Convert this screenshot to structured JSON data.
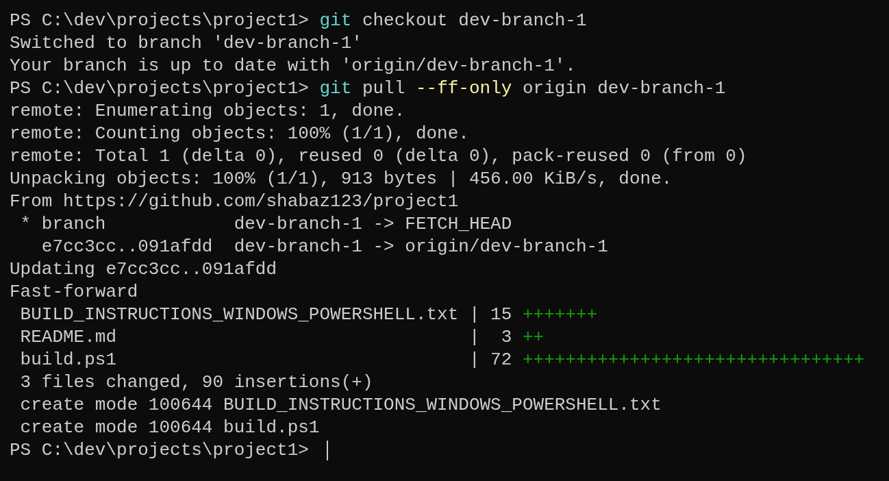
{
  "terminal": {
    "lines": [
      {
        "segments": [
          {
            "kind": "text",
            "text": "PS C:\\dev\\projects\\project1> "
          },
          {
            "kind": "command",
            "text": "git"
          },
          {
            "kind": "text",
            "text": " checkout dev-branch-1"
          }
        ]
      },
      {
        "segments": [
          {
            "kind": "text",
            "text": "Switched to branch 'dev-branch-1'"
          }
        ]
      },
      {
        "segments": [
          {
            "kind": "text",
            "text": "Your branch is up to date with 'origin/dev-branch-1'."
          }
        ]
      },
      {
        "segments": [
          {
            "kind": "text",
            "text": "PS C:\\dev\\projects\\project1> "
          },
          {
            "kind": "command",
            "text": "git"
          },
          {
            "kind": "text",
            "text": " pull "
          },
          {
            "kind": "flag",
            "text": "--ff-only"
          },
          {
            "kind": "text",
            "text": " origin dev-branch-1"
          }
        ]
      },
      {
        "segments": [
          {
            "kind": "text",
            "text": "remote: Enumerating objects: 1, done."
          }
        ]
      },
      {
        "segments": [
          {
            "kind": "text",
            "text": "remote: Counting objects: 100% (1/1), done."
          }
        ]
      },
      {
        "segments": [
          {
            "kind": "text",
            "text": "remote: Total 1 (delta 0), reused 0 (delta 0), pack-reused 0 (from 0)"
          }
        ]
      },
      {
        "segments": [
          {
            "kind": "text",
            "text": "Unpacking objects: 100% (1/1), 913 bytes | 456.00 KiB/s, done."
          }
        ]
      },
      {
        "segments": [
          {
            "kind": "text",
            "text": "From https://github.com/shabaz123/project1"
          }
        ]
      },
      {
        "segments": [
          {
            "kind": "text",
            "text": " * branch            dev-branch-1 -> FETCH_HEAD"
          }
        ]
      },
      {
        "segments": [
          {
            "kind": "text",
            "text": "   e7cc3cc..091afdd  dev-branch-1 -> origin/dev-branch-1"
          }
        ]
      },
      {
        "segments": [
          {
            "kind": "text",
            "text": "Updating e7cc3cc..091afdd"
          }
        ]
      },
      {
        "segments": [
          {
            "kind": "text",
            "text": "Fast-forward"
          }
        ]
      },
      {
        "segments": [
          {
            "kind": "text",
            "text": " BUILD_INSTRUCTIONS_WINDOWS_POWERSHELL.txt | 15 "
          },
          {
            "kind": "added",
            "text": "+++++++"
          }
        ]
      },
      {
        "segments": [
          {
            "kind": "text",
            "text": " README.md                                 |  3 "
          },
          {
            "kind": "added",
            "text": "++"
          }
        ]
      },
      {
        "segments": [
          {
            "kind": "text",
            "text": " build.ps1                                 | 72 "
          },
          {
            "kind": "added",
            "text": "++++++++++++++++++++++++++++++++"
          }
        ]
      },
      {
        "segments": [
          {
            "kind": "text",
            "text": " 3 files changed, 90 insertions(+)"
          }
        ]
      },
      {
        "segments": [
          {
            "kind": "text",
            "text": " create mode 100644 BUILD_INSTRUCTIONS_WINDOWS_POWERSHELL.txt"
          }
        ]
      },
      {
        "segments": [
          {
            "kind": "text",
            "text": " create mode 100644 build.ps1"
          }
        ]
      },
      {
        "segments": [
          {
            "kind": "text",
            "text": "PS C:\\dev\\projects\\project1> "
          }
        ]
      }
    ],
    "cursor": {
      "visible": true
    }
  }
}
